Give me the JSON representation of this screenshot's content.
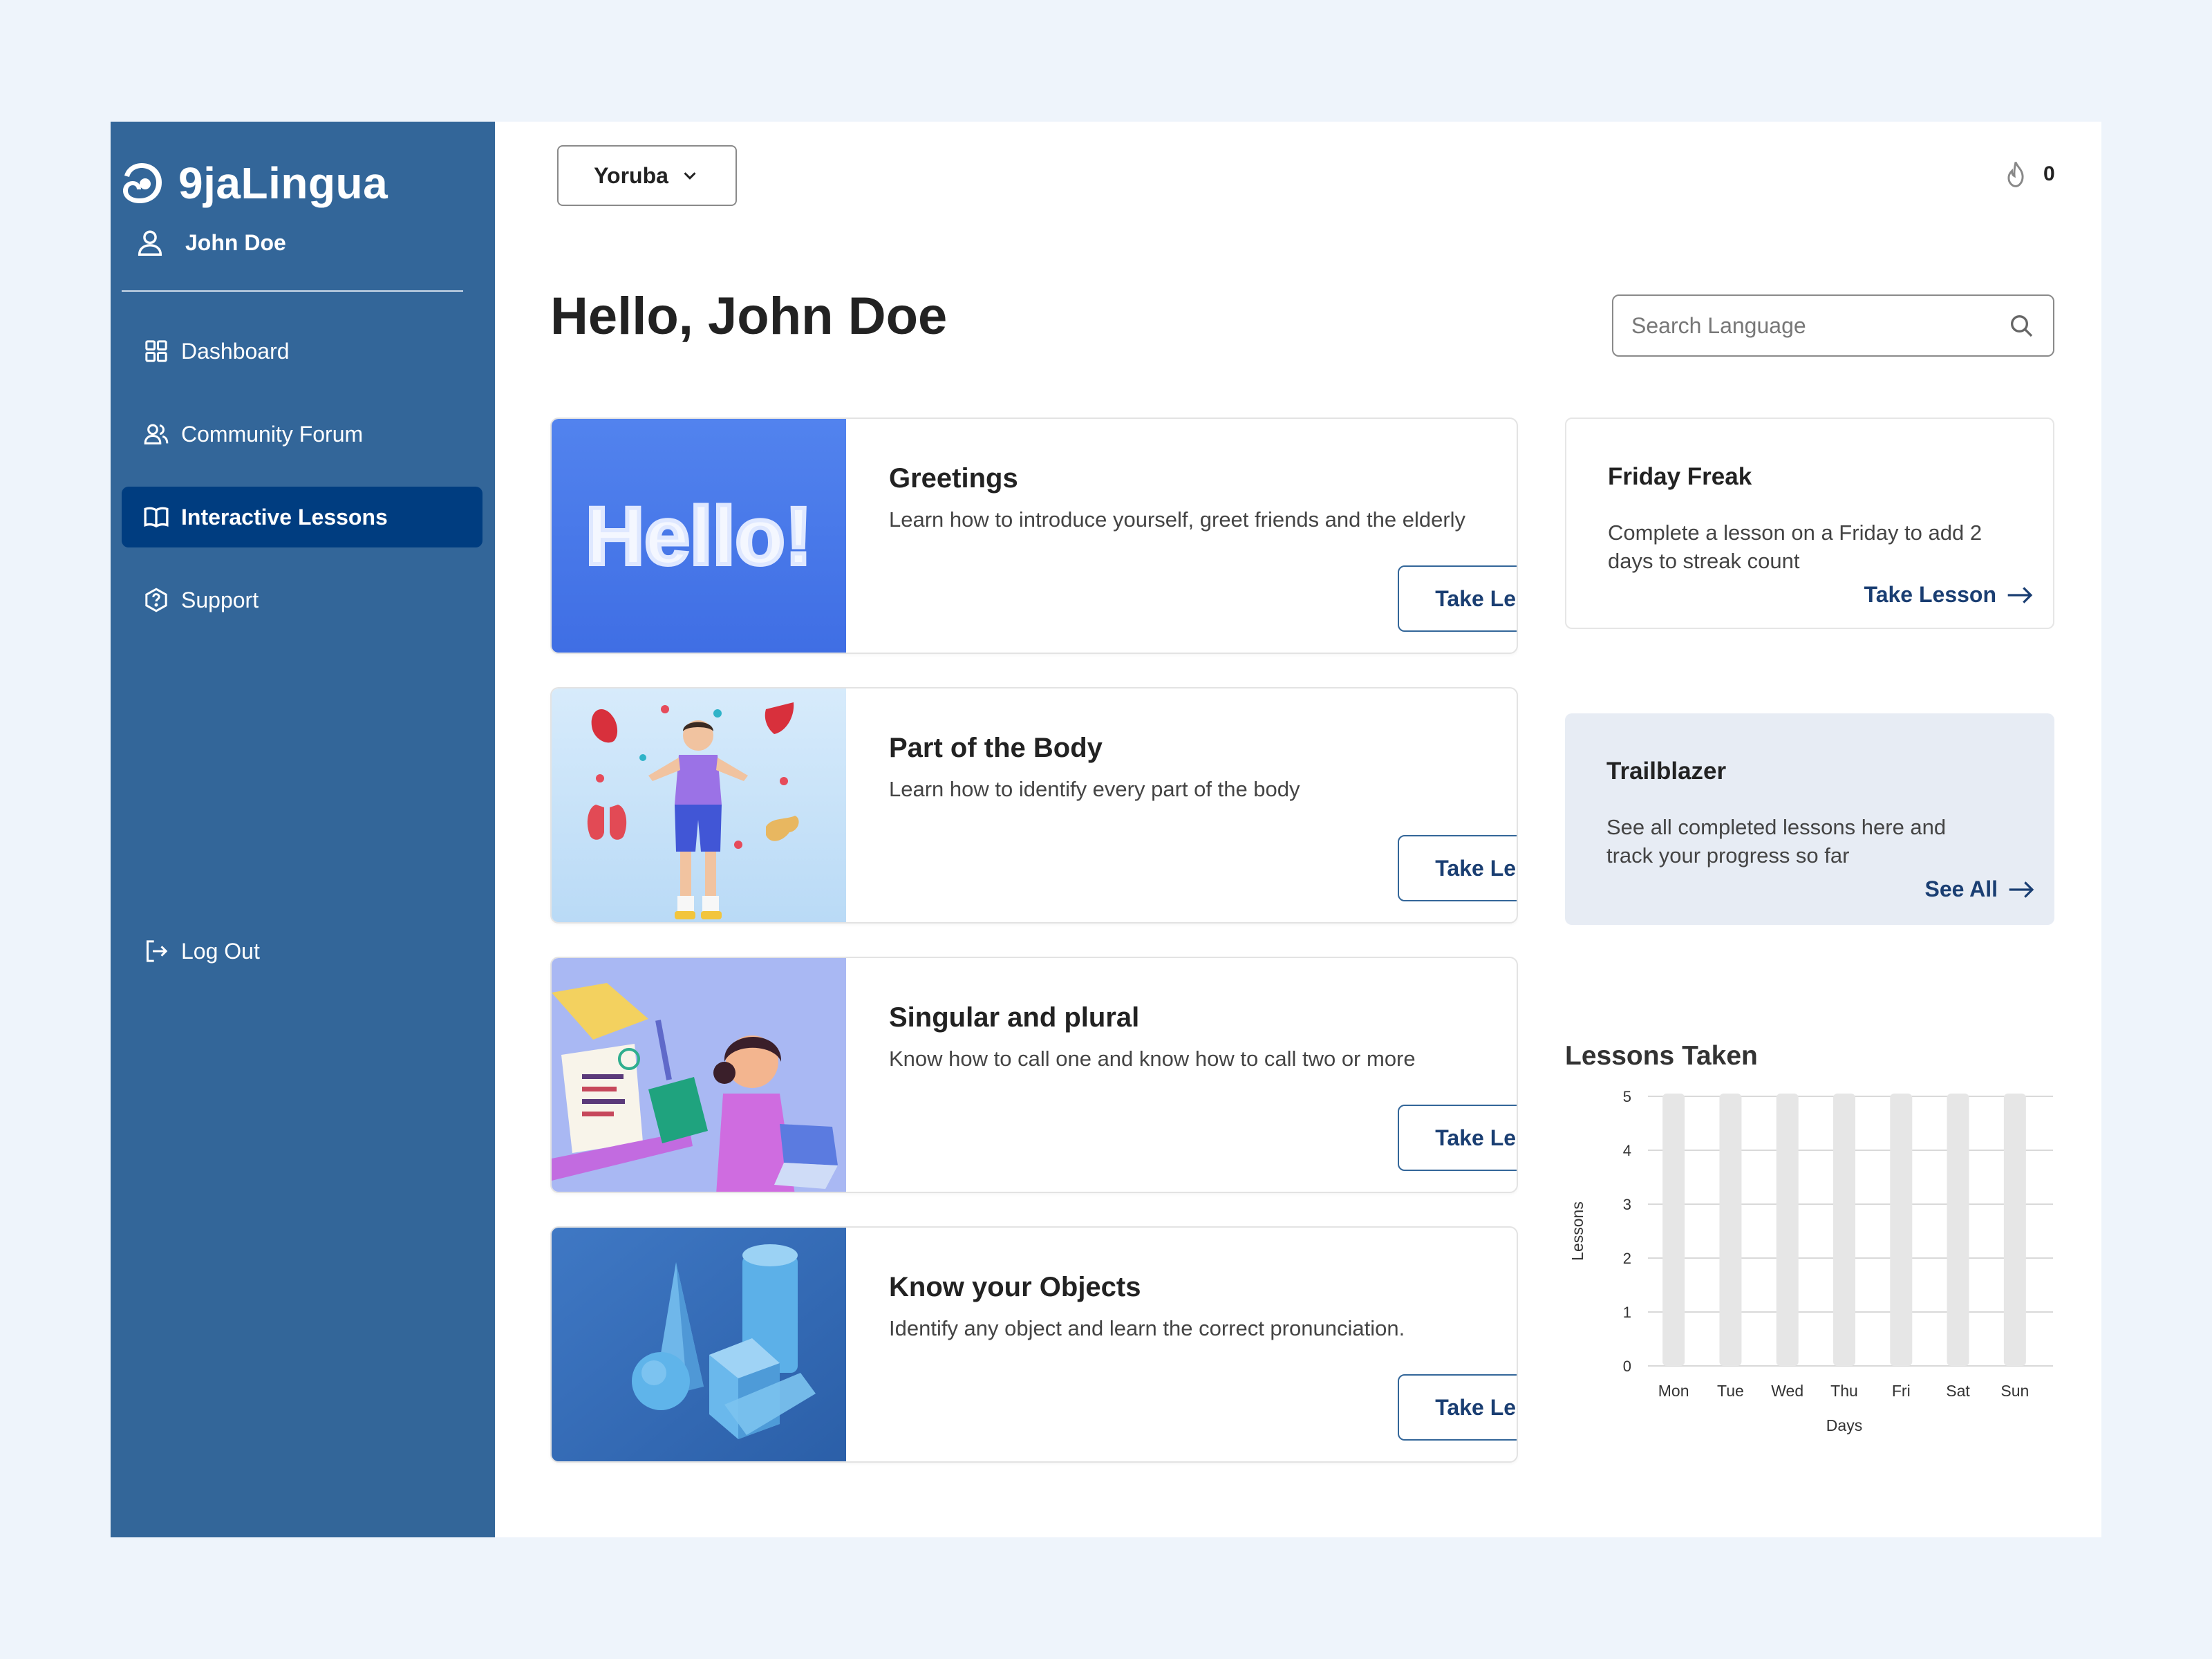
{
  "app": {
    "brand": "9jaLingua",
    "user_name": "John Doe"
  },
  "sidebar": {
    "items": [
      {
        "label": "Dashboard",
        "icon": "grid-icon"
      },
      {
        "label": "Community Forum",
        "icon": "users-icon"
      },
      {
        "label": "Interactive Lessons",
        "icon": "book-icon",
        "active": true
      },
      {
        "label": "Support",
        "icon": "help-hexagon-icon"
      }
    ],
    "logout_label": "Log Out"
  },
  "header": {
    "language": "Yoruba",
    "streak_count": "0"
  },
  "main": {
    "greeting": "Hello, John Doe",
    "search_placeholder": "Search Language"
  },
  "lessons": [
    {
      "title": "Greetings",
      "description": "Learn how to introduce yourself, greet friends and the elderly",
      "button": "Take Lesson",
      "thumb_text": "Hello!"
    },
    {
      "title": "Part of the Body",
      "description": "Learn how to identify every part of the body",
      "button": "Take Lesson"
    },
    {
      "title": "Singular and plural",
      "description": "Know how to call one and know how to call two or more",
      "button": "Take Lesson"
    },
    {
      "title": "Know your Objects",
      "description": "Identify any object and learn the correct pronunciation.",
      "button": "Take Lesson"
    }
  ],
  "cards": {
    "friday": {
      "title": "Friday Freak",
      "description": "Complete a lesson on a Friday to add 2 days to streak count",
      "link": "Take Lesson"
    },
    "trailblazer": {
      "title": "Trailblazer",
      "description": "See all completed lessons here and track your progress so far",
      "link": "See All"
    }
  },
  "colors": {
    "sidebar": "#336699",
    "active_nav": "#003d80",
    "accent_text": "#1a3e72",
    "bar": "#e6e6e6"
  },
  "chart_data": {
    "type": "bar",
    "title": "Lessons Taken",
    "xlabel": "Days",
    "ylabel": "Lessons",
    "categories": [
      "Mon",
      "Tue",
      "Wed",
      "Thu",
      "Fri",
      "Sat",
      "Sun"
    ],
    "values": [
      5,
      5,
      5,
      5,
      5,
      5,
      5
    ],
    "ylim": [
      0,
      5
    ],
    "yticks": [
      0,
      1,
      2,
      3,
      4,
      5
    ],
    "grid": true
  }
}
